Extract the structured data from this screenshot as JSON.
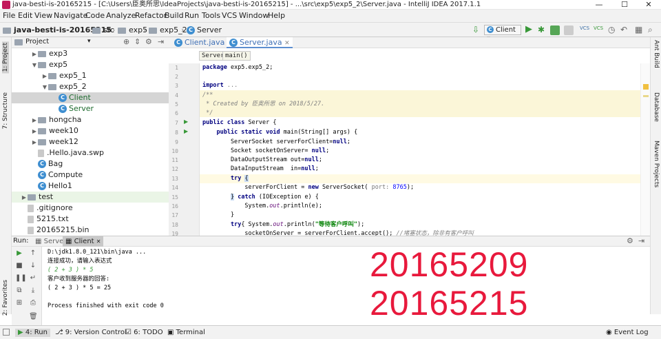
{
  "window": {
    "title": "java-besti-is-20165215 - [C:\\Users\\臣奥所思\\IdeaProjects\\java-besti-is-20165215] - ...\\src\\exp5\\exp5_2\\Server.java - IntelliJ IDEA 2017.1.1",
    "controls": {
      "minimize": "—",
      "maximize": "☐",
      "close": "✕"
    }
  },
  "menu": [
    "File",
    "Edit",
    "View",
    "Navigate",
    "Code",
    "Analyze",
    "Refactor",
    "Build",
    "Run",
    "Tools",
    "VCS",
    "Window",
    "Help"
  ],
  "navbar": {
    "breadcrumb": [
      "java-besti-is-20165215",
      "src",
      "exp5",
      "exp5_2",
      "Server"
    ],
    "run_config": "Client",
    "vcs1": "VCS",
    "vcs2": "VCS"
  },
  "side_tabs": {
    "left": [
      "1: Project",
      "7: Structure",
      "2: Favorites"
    ],
    "right": [
      "Ant Build",
      "Database",
      "Maven Projects"
    ]
  },
  "project": {
    "view": "Project",
    "tree": [
      {
        "label": "exp3",
        "kind": "folder",
        "depth": 2,
        "arrow": "▶"
      },
      {
        "label": "exp5",
        "kind": "folder",
        "depth": 2,
        "arrow": "▼"
      },
      {
        "label": "exp5_1",
        "kind": "folder",
        "depth": 3,
        "arrow": "▶"
      },
      {
        "label": "exp5_2",
        "kind": "folder",
        "depth": 3,
        "arrow": "▼"
      },
      {
        "label": "Client",
        "kind": "class",
        "depth": 4,
        "arrow": "",
        "selected": true
      },
      {
        "label": "Server",
        "kind": "class",
        "depth": 4,
        "arrow": ""
      },
      {
        "label": "hongcha",
        "kind": "folder",
        "depth": 2,
        "arrow": "▶"
      },
      {
        "label": "week10",
        "kind": "folder",
        "depth": 2,
        "arrow": "▶"
      },
      {
        "label": "week12",
        "kind": "folder",
        "depth": 2,
        "arrow": "▶"
      },
      {
        "label": ".Hello.java.swp",
        "kind": "file",
        "depth": 2,
        "arrow": ""
      },
      {
        "label": "Bag",
        "kind": "class",
        "depth": 2,
        "arrow": ""
      },
      {
        "label": "Compute",
        "kind": "class",
        "depth": 2,
        "arrow": ""
      },
      {
        "label": "Hello1",
        "kind": "class",
        "depth": 2,
        "arrow": ""
      },
      {
        "label": "test",
        "kind": "folder",
        "depth": 1,
        "arrow": "▶",
        "green": true
      },
      {
        "label": ".gitignore",
        "kind": "file",
        "depth": 1,
        "arrow": ""
      },
      {
        "label": "5215.txt",
        "kind": "file",
        "depth": 1,
        "arrow": ""
      },
      {
        "label": "20165215.bin",
        "kind": "file",
        "depth": 1,
        "arrow": ""
      }
    ]
  },
  "editor": {
    "tabs": [
      "Client.java",
      "Server.java"
    ],
    "active_tab": "Server.java",
    "crumbs": [
      "Server",
      "main()"
    ],
    "line_numbers": [
      "1",
      "2",
      "3",
      "4",
      "5",
      "6",
      "7",
      "8",
      "9",
      "10",
      "11",
      "12",
      "13",
      "14",
      "15",
      "16",
      "17",
      "18",
      "19",
      "20",
      "21"
    ]
  },
  "run": {
    "label": "Run:",
    "tabs": [
      "Server",
      "Client"
    ],
    "active_tab": "Client",
    "console": [
      "D:\\jdk1.8.0_121\\bin\\java ...",
      "连接成功，请输入表达式",
      "( 2 + 3 ) * 5",
      "客户收到服务器的回答:",
      "( 2 + 3 ) * 5 = 25",
      "",
      "Process finished with exit code 0"
    ],
    "overlay": [
      "20165209",
      "20165215"
    ]
  },
  "statusbar": {
    "items": [
      "4: Run",
      "9: Version Control",
      "6: TODO",
      "Terminal"
    ],
    "event_log": "Event Log"
  },
  "colors": {
    "accent_red": "#e8193c",
    "run_green": "#389838",
    "class_blue": "#3e8ed0"
  }
}
